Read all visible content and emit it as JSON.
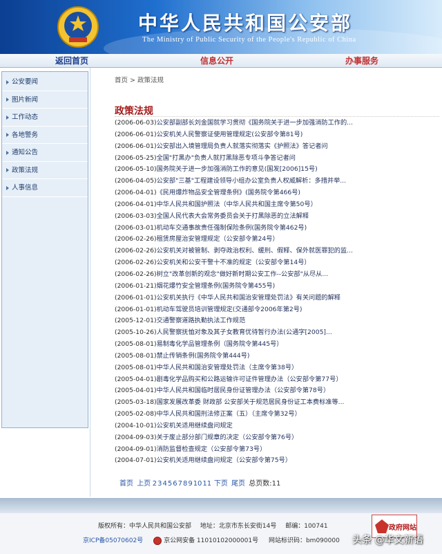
{
  "header": {
    "title": "中华人民共和国公安部",
    "subtitle": "The Ministry of Public Security of the People's Republic of China"
  },
  "nav": {
    "home": "返回首页",
    "info": "信息公开",
    "service": "办事服务"
  },
  "sidebar": {
    "items": [
      {
        "label": "公安要闻"
      },
      {
        "label": "图片新闻"
      },
      {
        "label": "工作动态"
      },
      {
        "label": "各地警务"
      },
      {
        "label": "通知公告"
      },
      {
        "label": "政策法规"
      },
      {
        "label": "人事信息"
      }
    ]
  },
  "breadcrumb": {
    "home": "首页",
    "separator": " > ",
    "current": "政策法规"
  },
  "main": {
    "section_title": "政策法规",
    "articles": [
      {
        "date": "(2006-06-03)",
        "title": "公安部副部长刘金国就学习贯彻《国务院关于进一步加强消防工作的..."
      },
      {
        "date": "(2006-06-01)",
        "title": "公安机关人民警察证使用管理规定(公安部令第81号)"
      },
      {
        "date": "(2006-06-01)",
        "title": "公安部出入境管理局负责人就落实彻落实《护照法》答记者问"
      },
      {
        "date": "(2006-05-25)",
        "title": "全国\"打黑办\"负责人就打黑除恶专项斗争答记者问"
      },
      {
        "date": "(2006-05-10)",
        "title": "国务院关于进一步加强消防工作的意见(国发[2006]15号)"
      },
      {
        "date": "(2006-04-05)",
        "title": "公安部\"三基\"工程建设领导小组办公室负责人权威解析：多措并举..."
      },
      {
        "date": "(2006-04-01)",
        "title": "《民用爆炸物品安全管理条例》(国务院令第466号)"
      },
      {
        "date": "(2006-04-01)",
        "title": "中华人民共和国护照法（中华人民共和国主席令第50号）"
      },
      {
        "date": "(2006-03-03)",
        "title": "全国人民代表大会常务委员会关于打黑除恶的立法解释"
      },
      {
        "date": "(2006-03-01)",
        "title": "机动车交通事故责任强制保险条例(国务院令第462号)"
      },
      {
        "date": "(2006-02-26)",
        "title": "租赁房屋治安管理规定（公安部令第24号）"
      },
      {
        "date": "(2006-02-26)",
        "title": "公安机关对被管制、剥夺政治权利、缓刑、假释、保外就医罪犯的监..."
      },
      {
        "date": "(2006-02-26)",
        "title": "公安机关和公安干警十不准的规定（公安部令第14号）"
      },
      {
        "date": "(2006-02-26)",
        "title": "树立\"改革创新的观念\"做好新时期公安工作--公安部\"从尽从..."
      },
      {
        "date": "(2006-01-21)",
        "title": "烟花爆竹安全管理条例(国务院令第455号)"
      },
      {
        "date": "(2006-01-01)",
        "title": "公安机关执行《中华人民共和国治安管理处罚法》有关问题的解释"
      },
      {
        "date": "(2006-01-01)",
        "title": "机动车驾驶员培训管理规定(交通部令2006年第2号)"
      },
      {
        "date": "(2005-12-01)",
        "title": "交通警察道路执勤执法工作规范"
      },
      {
        "date": "(2005-10-26)",
        "title": "人民警察抚恤对象及其子女教育优待暂行办法(公通字[2005]..."
      },
      {
        "date": "(2005-08-01)",
        "title": "易制毒化学品管理条例（国务院令第445号）"
      },
      {
        "date": "(2005-08-01)",
        "title": "禁止传销条例(国务院令第444号)"
      },
      {
        "date": "(2005-08-01)",
        "title": "中华人民共和国治安管理处罚法（主席令第38号）"
      },
      {
        "date": "(2005-04-01)",
        "title": "剧毒化学品购买和公路运输许可证件管理办法（公安部令第77号）"
      },
      {
        "date": "(2005-04-01)",
        "title": "中华人民共和国临时居民身份证管理办法（公安部令第78号）"
      },
      {
        "date": "(2005-03-18)",
        "title": "国家发展改革委 财政部 公安部关于规范居民身份证工本费标准等..."
      },
      {
        "date": "(2005-02-08)",
        "title": "中华人民共和国刑法修正案（五）（主席令第32号）"
      },
      {
        "date": "(2004-10-01)",
        "title": "公安机关适用继续盘问规定"
      },
      {
        "date": "(2004-09-03)",
        "title": "关于废止部分部门规章的决定（公安部令第76号）"
      },
      {
        "date": "(2004-09-01)",
        "title": "消防监督检查规定（公安部令第73号）"
      },
      {
        "date": "(2004-07-01)",
        "title": "公安机关适用继续盘问规定（公安部令第75号）"
      }
    ]
  },
  "pager": {
    "first": "首页",
    "prev": "上页",
    "pages": [
      "2",
      "3",
      "4",
      "5",
      "6",
      "7",
      "8",
      "9",
      "10",
      "11"
    ],
    "next": "下页",
    "last": "尾页",
    "total": "总页数:11"
  },
  "footer": {
    "copyright": "版权所有：中华人民共和国公安部",
    "address": "地址：北京市东长安街14号",
    "postcode": "邮编：100741",
    "icp": "京ICP备05070602号",
    "security": "京公网安备 11010102000001号",
    "site_id": "网站标识码：bm090000",
    "gov_badge": "政府网站"
  },
  "watermark": "头条 @华文新语",
  "colors": {
    "header_blue": "#0b3f92",
    "section_red": "#a51d1d",
    "link_blue": "#2a55a6"
  }
}
